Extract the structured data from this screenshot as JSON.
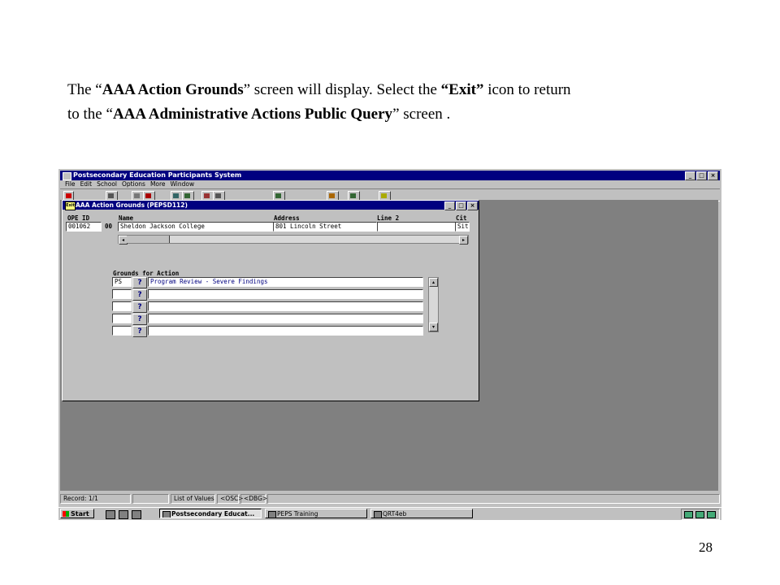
{
  "caption": {
    "l1_a": "The “",
    "l1_b": "AAA Action Grounds",
    "l1_c": "” screen will display.  Select the ",
    "l1_d": "“Exit”",
    "l1_e": " icon to return",
    "l2_a": "to the “",
    "l2_b": "AAA Administrative Actions Public Query",
    "l2_c": "” screen ."
  },
  "page_number": "28",
  "app": {
    "title": "Postsecondary Education Participants System",
    "menus": [
      "File",
      "Edit",
      "School",
      "Options",
      "More",
      "Window"
    ]
  },
  "inner_window": {
    "title": "AAA Action Grounds (PEPSD112)",
    "exit_label": "Exit",
    "labels": {
      "ope_id": "OPE ID",
      "name": "Name",
      "address": "Address",
      "line2": "Line 2",
      "city": "Cit"
    },
    "values": {
      "ope_id": "001062",
      "ope_suffix": "00",
      "name": "Sheldon Jackson College",
      "address": "801 Lincoln Street",
      "line2": "",
      "city": "Sit"
    },
    "grounds_label": "Grounds for Action",
    "grounds_rows": [
      {
        "code": "PS",
        "description": "Program Review - Severe Findings"
      },
      {
        "code": "",
        "description": ""
      },
      {
        "code": "",
        "description": ""
      },
      {
        "code": "",
        "description": ""
      },
      {
        "code": "",
        "description": ""
      }
    ]
  },
  "status": {
    "record": "Record: 1/1",
    "lov": "List of Values",
    "osc": "<OSC>",
    "dbg": "<DBG>"
  },
  "taskbar": {
    "start": "Start",
    "tasks": [
      "Postsecondary Educat...",
      "PEPS Training",
      "QRT4eb"
    ]
  }
}
